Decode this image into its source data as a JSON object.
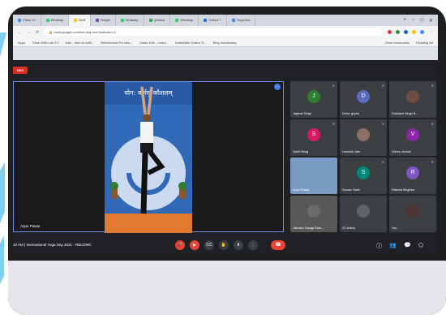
{
  "browser": {
    "tabs": [
      {
        "label": "Class 10",
        "color": "#4285f4"
      },
      {
        "label": "Whatsap",
        "color": "#25d366"
      },
      {
        "label": "Nmli",
        "color": "#fbbc05"
      },
      {
        "label": "Regist",
        "color": "#7248b9"
      },
      {
        "label": "Whatsap",
        "color": "#25d366"
      },
      {
        "label": "Questio",
        "color": "#34a853"
      },
      {
        "label": "Whatsap",
        "color": "#25d366"
      },
      {
        "label": "School T",
        "color": "#1a73e8"
      },
      {
        "label": "Yoga Ass",
        "color": "#4285f4"
      }
    ],
    "url": "meet.google.com/bvk-rdnj-rsm?authuser=0",
    "bookmarks": [
      "Apps",
      "Think With Lab 2.0",
      "Intel - Intro to Artifi...",
      "Referencias Pa visio...",
      "Class 10th - Learn...",
      "IndiaSkills Online Tr...",
      "Bing Vocabulary"
    ],
    "bookmarks_right": [
      "Other bookmarks",
      "Reading list"
    ],
    "extensions": [
      "#e53935",
      "#3d8b3d",
      "#1565c0",
      "#fbbc05",
      "#4285f4"
    ]
  },
  "meet": {
    "rec_label": "REC",
    "banner_text": "योग: कर्मसु कौशलम्",
    "main_name": "Arjun Pawar",
    "meeting_time": "10 AM",
    "meeting_title": "International Yoga Day 2021 - RBCDMC",
    "participants": [
      {
        "initial": "J",
        "name": "Jagmal Singh",
        "color": "#2e7d32"
      },
      {
        "initial": "D",
        "name": "Dhruv gupta",
        "color": "#5c6bc0"
      },
      {
        "initial": "",
        "name": "Subhash Singh B...",
        "color": "#6d4c41"
      },
      {
        "initial": "S",
        "name": "Sahil Sihag",
        "color": "#d81b60"
      },
      {
        "initial": "",
        "name": "Lavkush Jain",
        "color": "#8d6e63"
      },
      {
        "initial": "V",
        "name": "Vishnu Kumar",
        "color": "#8e24aa"
      },
      {
        "initial": "",
        "name": "Arjun Pawar",
        "color": "#7a9cc4"
      },
      {
        "initial": "S",
        "name": "Sourav Saini",
        "color": "#00897b"
      },
      {
        "initial": "R",
        "name": "Ritesha Meghwa",
        "color": "#7e57c2"
      },
      {
        "initial": "",
        "name": "Jitendra Ganga Ram...",
        "color": "#6a6a6a"
      },
      {
        "initial": "",
        "name": "22 others",
        "color": "#5f6368"
      },
      {
        "initial": "",
        "name": "You",
        "color": "#4e342e"
      }
    ]
  }
}
